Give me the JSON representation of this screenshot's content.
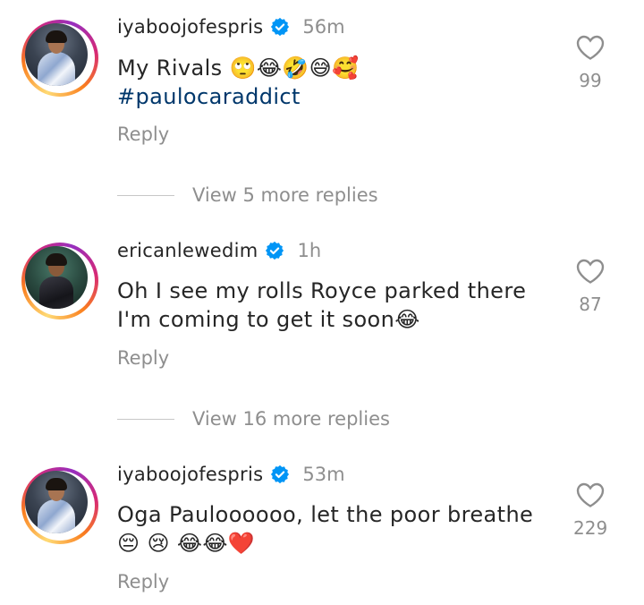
{
  "comments": [
    {
      "username": "iyaboojofespris",
      "time": "56m",
      "text": "My Rivals 🙄😂🤣😅🥰",
      "hashtag": "#paulocaraddict",
      "reply_label": "Reply",
      "likes": "99",
      "view_more": "View 5 more replies"
    },
    {
      "username": "ericanlewedim",
      "time": "1h",
      "text": "Oh I see my rolls Royce parked there\nI'm coming to get it soon😂",
      "reply_label": "Reply",
      "likes": "87",
      "view_more": "View 16 more replies"
    },
    {
      "username": "iyaboojofespris",
      "time": "53m",
      "text": "Oga Pauloooooo, let the poor breathe\n😔 😢 😂😂❤️",
      "reply_label": "Reply",
      "likes": "229"
    }
  ],
  "colors": {
    "verified": "#0095f6",
    "secondary_text": "#8e8e8e",
    "hashtag": "#00376b"
  },
  "icons": {
    "verified": "verified-badge-icon",
    "like": "heart-outline-icon"
  }
}
